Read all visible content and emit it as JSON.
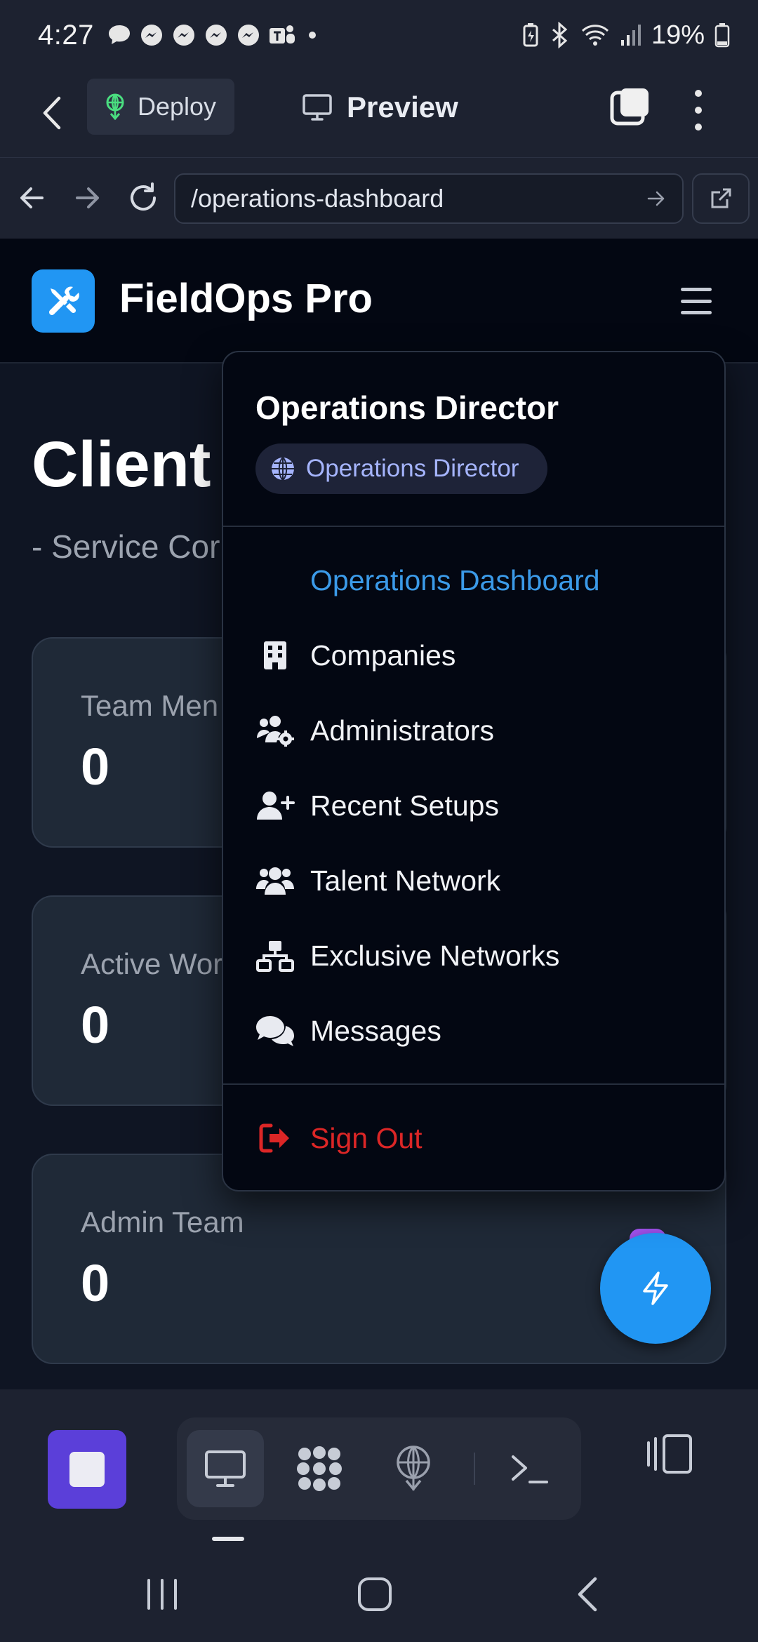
{
  "status_bar": {
    "time": "4:27",
    "battery_percent": "19%",
    "notification_icons": [
      "chat-bubble-icon",
      "messenger-icon",
      "messenger-icon",
      "messenger-icon",
      "messenger-icon",
      "teams-icon"
    ],
    "system_icons": [
      "battery-saver-icon",
      "bluetooth-icon",
      "wifi-icon",
      "signal-icon",
      "battery-icon"
    ]
  },
  "top_bar": {
    "deploy_label": "Deploy",
    "preview_label": "Preview"
  },
  "browser": {
    "url": "/operations-dashboard"
  },
  "app": {
    "brand": "FieldOps Pro",
    "brand_color": "#2196f3"
  },
  "page": {
    "title": "Client",
    "subtitle": "- Service Cor"
  },
  "stats": [
    {
      "label": "Team Men",
      "value": "0"
    },
    {
      "label": "Active Wor",
      "value": "0"
    },
    {
      "label": "Admin Team",
      "value": "0"
    }
  ],
  "menu": {
    "role_title": "Operations Director",
    "role_badge": "Operations Director",
    "items": [
      {
        "label": "Operations Dashboard",
        "icon": "none",
        "active": true
      },
      {
        "label": "Companies",
        "icon": "building-icon"
      },
      {
        "label": "Administrators",
        "icon": "users-cog-icon"
      },
      {
        "label": "Recent Setups",
        "icon": "user-plus-icon"
      },
      {
        "label": "Talent Network",
        "icon": "users-icon"
      },
      {
        "label": "Exclusive Networks",
        "icon": "network-wired-icon"
      },
      {
        "label": "Messages",
        "icon": "comments-icon"
      }
    ],
    "sign_out_label": "Sign Out",
    "active_color": "#3b9ae8",
    "danger_color": "#dc2626"
  },
  "toolbar": {
    "stop_color": "#5b3fd9",
    "tools": [
      "monitor-icon",
      "apps-grid-icon",
      "deploy-icon",
      "terminal-icon"
    ],
    "device_toggle_icon": "device-frame-icon"
  }
}
